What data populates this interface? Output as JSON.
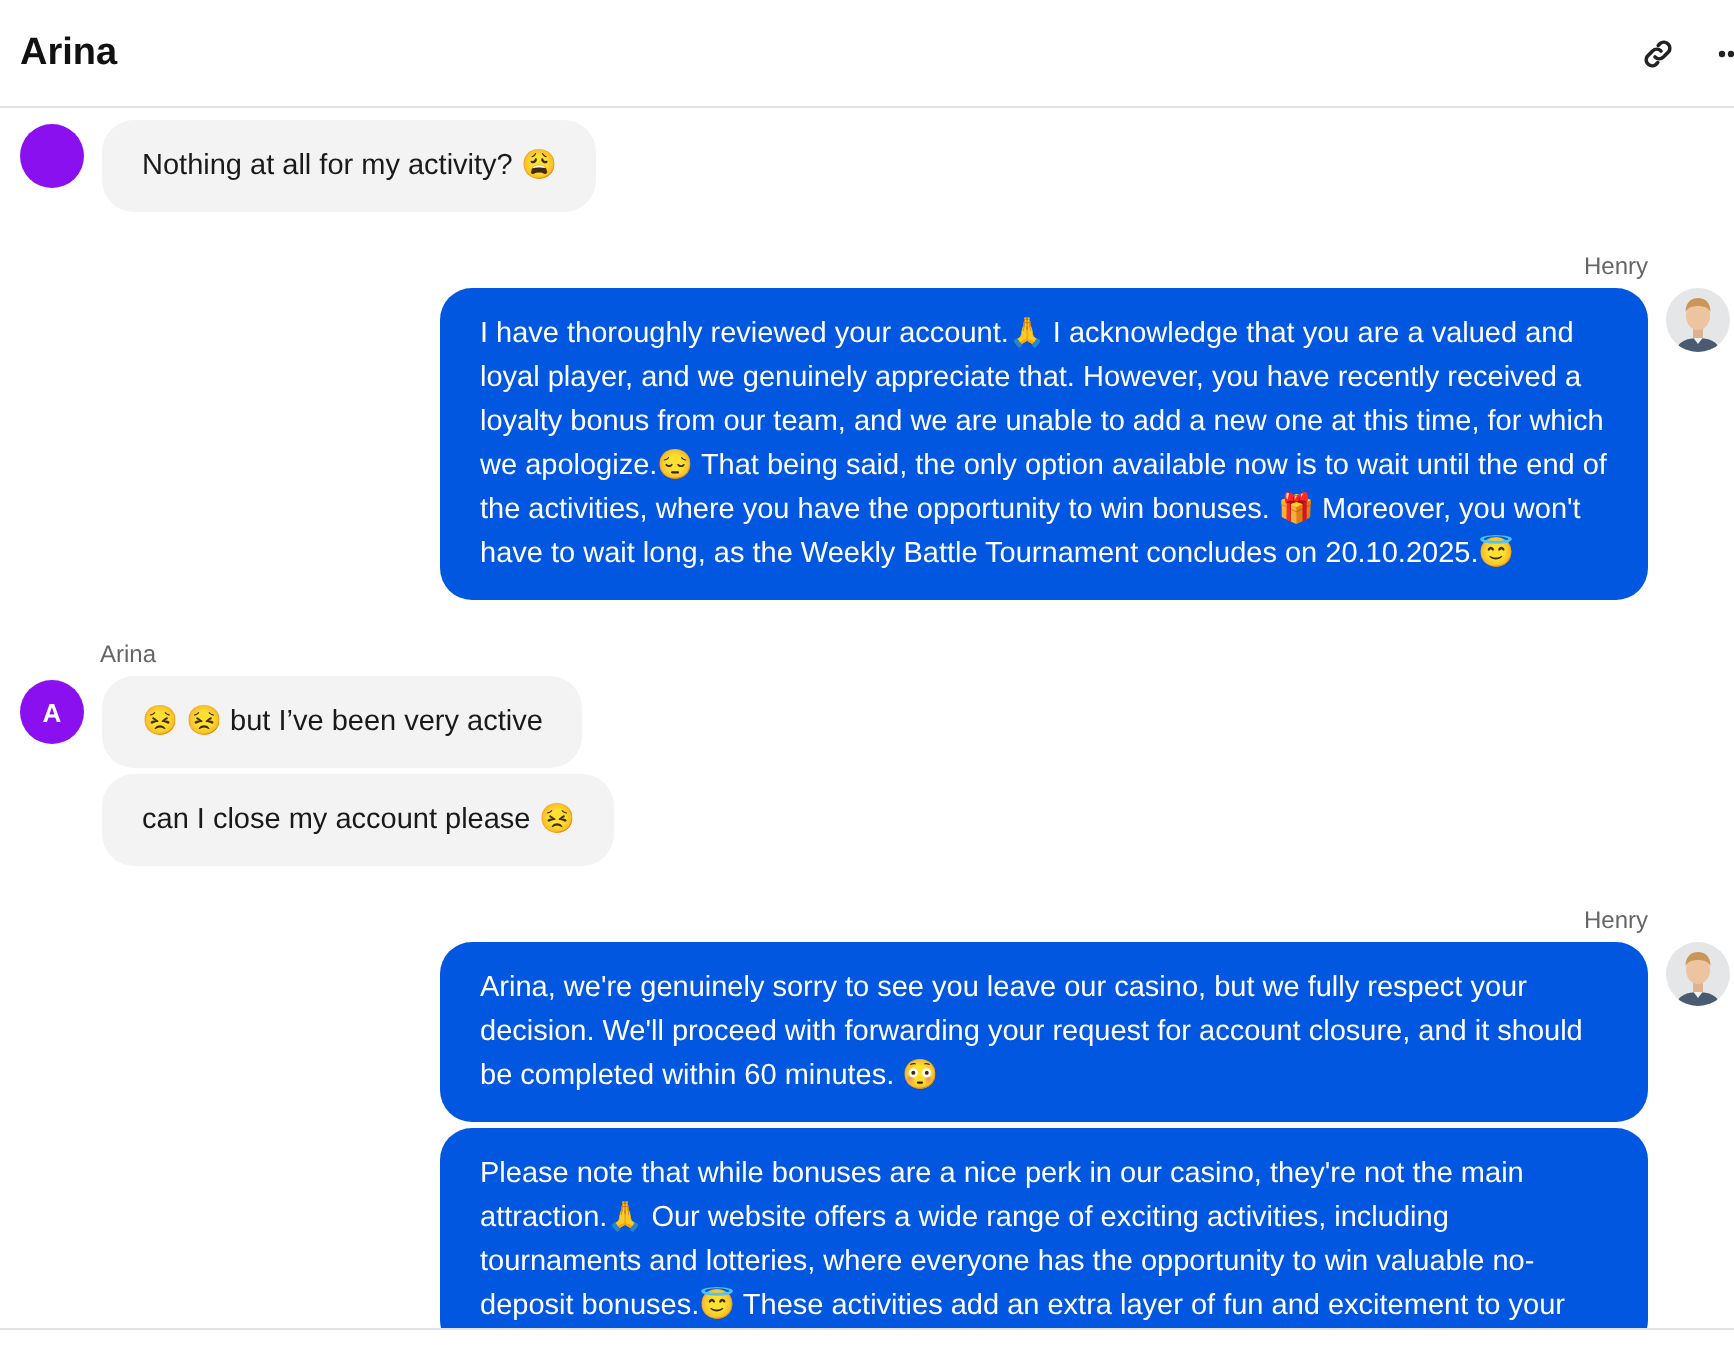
{
  "header": {
    "title": "Arina"
  },
  "groups": [
    {
      "kind": "incoming",
      "avatar": {
        "kind": "initial"
      },
      "bubbles": [
        "Nothing at all for my activity? 😩"
      ]
    },
    {
      "kind": "outgoing",
      "sender": "Henry",
      "avatar": {
        "kind": "picture"
      },
      "bubbles": [
        "I have thoroughly reviewed your account.🙏 I acknowledge that you are a valued and loyal player, and we genuinely appreciate that. However, you have recently received a loyalty bonus from our team, and we are unable to add a new one at this time, for which we apologize.😔 That being said, the only option available now is to wait until the end of the activities, where you have the opportunity to win bonuses. 🎁 Moreover, you won't have to wait long, as the Weekly Battle Tournament concludes on 20.10.2025.😇"
      ]
    },
    {
      "kind": "incoming",
      "sender": "Arina",
      "avatar": {
        "kind": "initial",
        "text": "A"
      },
      "bubbles": [
        "😣 😣 but I’ve been very active",
        "can I close my account please 😣"
      ]
    },
    {
      "kind": "outgoing",
      "sender": "Henry",
      "avatar": {
        "kind": "picture"
      },
      "bubbles": [
        "Arina, we're genuinely sorry to see you leave our casino, but we fully respect your decision. We'll proceed with forwarding your request for account closure, and it should be completed within 60 minutes. 😳",
        "Please note that while bonuses are a nice perk in our casino, they're not the main attraction.🙏 Our website offers a wide range of exciting activities, including tournaments and lotteries, where everyone has the opportunity to win valuable no-deposit bonuses.😇 These activities add an extra layer of fun and excitement to your"
      ]
    }
  ]
}
